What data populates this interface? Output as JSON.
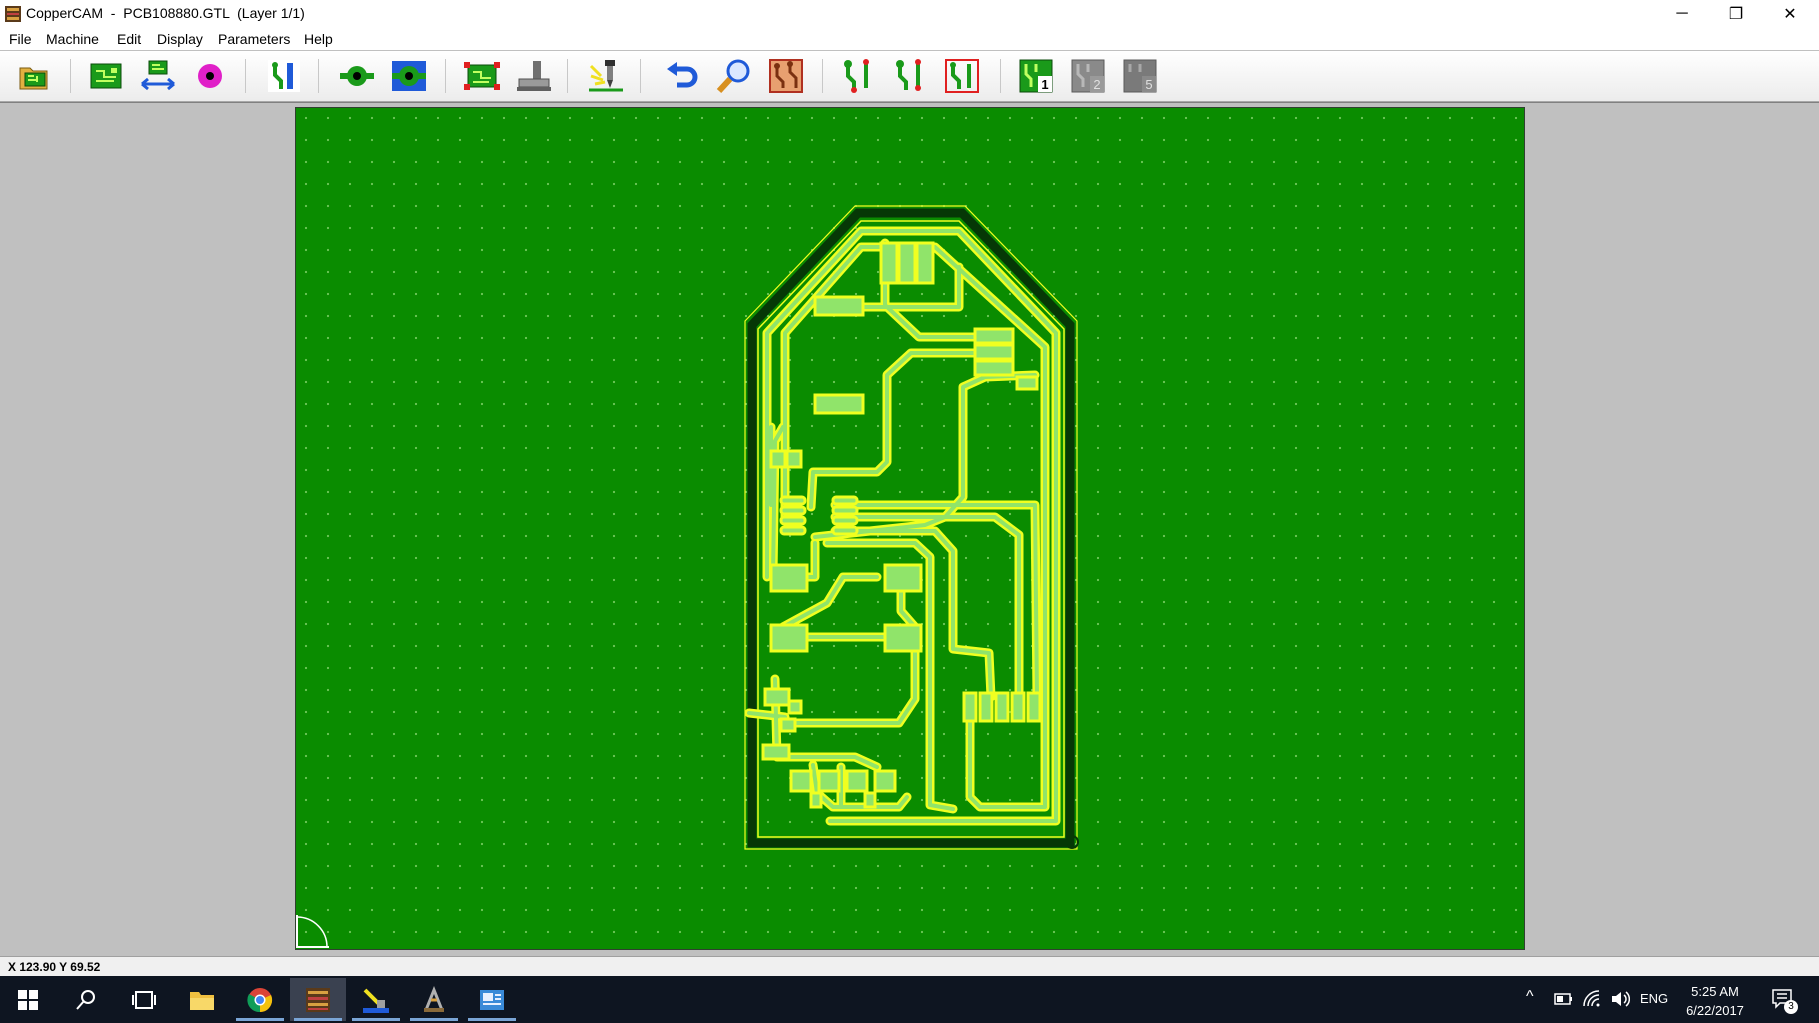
{
  "window": {
    "title": "CopperCAM  -  PCB108880.GTL  (Layer 1/1)",
    "controls": {
      "minimize": "─",
      "restore": "❐",
      "close": "✕"
    }
  },
  "menu": [
    "File",
    "Machine",
    "Edit",
    "Display",
    "Parameters",
    "Help"
  ],
  "toolbar": {
    "buttons": [
      {
        "name": "open-file",
        "icon": "open-folder-icon"
      },
      {
        "name": "board-dimensions",
        "icon": "pcb-board-icon"
      },
      {
        "name": "mirror",
        "icon": "mirror-arrows-icon"
      },
      {
        "name": "set-origin",
        "icon": "origin-target-icon"
      },
      {
        "name": "track-properties",
        "icon": "track-select-icon"
      },
      {
        "name": "pad-properties",
        "icon": "pad-icon"
      },
      {
        "name": "pad-centering",
        "icon": "pad-center-icon"
      },
      {
        "name": "select-all",
        "icon": "select-board-icon"
      },
      {
        "name": "tool-library",
        "icon": "tool-icon"
      },
      {
        "name": "engrave",
        "icon": "engrave-tool-icon"
      },
      {
        "name": "undo",
        "icon": "undo-icon"
      },
      {
        "name": "zoom",
        "icon": "magnifier-icon"
      },
      {
        "name": "board-view",
        "icon": "copper-board-icon"
      },
      {
        "name": "contours-1",
        "icon": "contour-1-icon"
      },
      {
        "name": "contours-2",
        "icon": "contour-2-icon"
      },
      {
        "name": "contours-3",
        "icon": "contour-3-icon"
      },
      {
        "name": "layer-1",
        "icon": "layer-1-icon",
        "label": "1"
      },
      {
        "name": "layer-2",
        "icon": "layer-2-icon",
        "label": "2"
      },
      {
        "name": "layer-5",
        "icon": "layer-5-icon",
        "label": "5"
      }
    ]
  },
  "status": {
    "coords": "X 123.90   Y 69.52"
  },
  "taskbar": {
    "apps": [
      "start-icon",
      "search-icon",
      "task-view-icon",
      "file-explorer-icon",
      "chrome-icon",
      "coppercam-icon",
      "pcb-tool-icon",
      "cnc-tool-icon",
      "viewer-icon"
    ],
    "lang": "ENG",
    "time": "5:25 AM",
    "date": "6/22/2017",
    "notifications": "3"
  },
  "colors": {
    "board_bg": "#0a8c00",
    "track_fill": "#90e46a",
    "track_outline": "#f0ff20",
    "dark_outline": "#063806"
  }
}
